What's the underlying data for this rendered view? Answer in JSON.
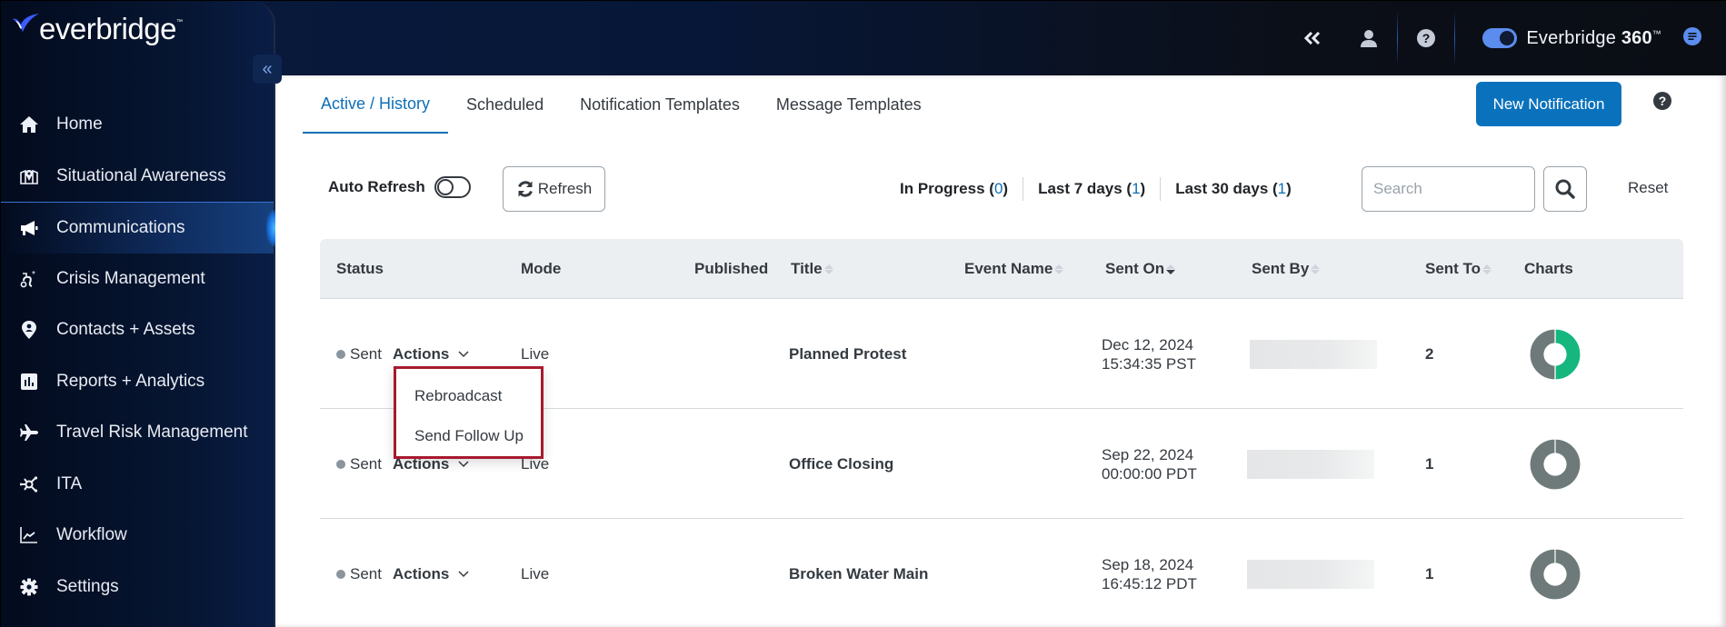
{
  "brand": {
    "logo_text": "everbridge",
    "logo_tm": "™",
    "product_name": "Everbridge",
    "product_suffix": "360",
    "product_tm": "™"
  },
  "topbar": {
    "icons": [
      "collapse-double-chevron-icon",
      "user-icon",
      "help-icon",
      "toggle-360-switch",
      "chat-icon"
    ],
    "toggle_360_on": true
  },
  "sidebar": {
    "collapse_label": "«",
    "items": [
      {
        "label": "Home",
        "icon": "home-icon",
        "active": false
      },
      {
        "label": "Situational Awareness",
        "icon": "map-pin-icon",
        "active": false
      },
      {
        "label": "Communications",
        "icon": "megaphone-icon",
        "active": true
      },
      {
        "label": "Crisis Management",
        "icon": "crisis-route-icon",
        "active": false
      },
      {
        "label": "Contacts + Assets",
        "icon": "location-person-icon",
        "active": false
      },
      {
        "label": "Reports + Analytics",
        "icon": "bar-chart-icon",
        "active": false
      },
      {
        "label": "Travel Risk Management",
        "icon": "airplane-icon",
        "active": false
      },
      {
        "label": "ITA",
        "icon": "network-icon",
        "active": false
      },
      {
        "label": "Workflow",
        "icon": "line-chart-icon",
        "active": false
      },
      {
        "label": "Settings",
        "icon": "gear-icon",
        "active": false
      }
    ]
  },
  "main": {
    "tabs": [
      {
        "label": "Active / History",
        "active": true
      },
      {
        "label": "Scheduled",
        "active": false
      },
      {
        "label": "Notification Templates",
        "active": false
      },
      {
        "label": "Message Templates",
        "active": false
      }
    ],
    "new_notification_label": "New Notification",
    "auto_refresh_label": "Auto Refresh",
    "auto_refresh_on": false,
    "refresh_label": "Refresh",
    "filters": [
      {
        "label": "In Progress",
        "count": "0"
      },
      {
        "label": "Last 7 days",
        "count": "1"
      },
      {
        "label": "Last 30 days",
        "count": "1"
      }
    ],
    "search_placeholder": "Search",
    "search_value": "",
    "reset_label": "Reset"
  },
  "table": {
    "columns": [
      {
        "label": "Status",
        "sortable": false
      },
      {
        "label": "Mode",
        "sortable": false
      },
      {
        "label": "Published",
        "sortable": false
      },
      {
        "label": "Title",
        "sortable": true
      },
      {
        "label": "Event Name",
        "sortable": true
      },
      {
        "label": "Sent On",
        "sortable": true,
        "sorted": "desc"
      },
      {
        "label": "Sent By",
        "sortable": true
      },
      {
        "label": "Sent To",
        "sortable": true
      },
      {
        "label": "Charts",
        "sortable": false
      }
    ],
    "rows": [
      {
        "status": "Sent",
        "actions": "Actions",
        "mode": "Live",
        "published": "",
        "title": "Planned Protest",
        "event_name": "",
        "sent_on_date": "Dec 12, 2024",
        "sent_on_time": "15:34:35 PST",
        "sent_by": "[redacted]",
        "sent_to": "2",
        "chart": {
          "green": 0.5,
          "gray": 0.5
        }
      },
      {
        "status": "Sent",
        "actions": "Actions",
        "mode": "Live",
        "published": "",
        "title": "Office Closing",
        "event_name": "",
        "sent_on_date": "Sep 22, 2024",
        "sent_on_time": "00:00:00 PDT",
        "sent_by": "[redacted]",
        "sent_to": "1",
        "chart": {
          "green": 0,
          "gray": 1
        }
      },
      {
        "status": "Sent",
        "actions": "Actions",
        "mode": "Live",
        "published": "",
        "title": "Broken Water Main",
        "event_name": "",
        "sent_on_date": "Sep 18, 2024",
        "sent_on_time": "16:45:12 PDT",
        "sent_by": "[redacted]",
        "sent_to": "1",
        "chart": {
          "green": 0,
          "gray": 1
        }
      }
    ]
  },
  "actions_dropdown": {
    "open_for_row": 0,
    "items": [
      "Rebroadcast",
      "Send Follow Up"
    ]
  },
  "colors": {
    "accent": "#0a72bd",
    "tab_active": "#0d6fb8",
    "chart_green": "#16b77e",
    "chart_gray": "#6e7a7a",
    "dropdown_border": "#a8192e",
    "sidebar_bg": "#061633"
  }
}
